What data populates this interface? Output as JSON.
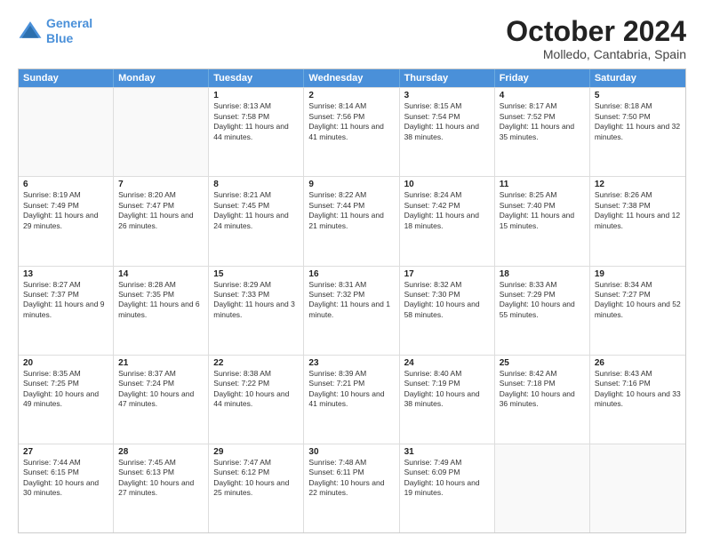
{
  "logo": {
    "line1": "General",
    "line2": "Blue"
  },
  "title": "October 2024",
  "location": "Molledo, Cantabria, Spain",
  "days_of_week": [
    "Sunday",
    "Monday",
    "Tuesday",
    "Wednesday",
    "Thursday",
    "Friday",
    "Saturday"
  ],
  "rows": [
    [
      {
        "day": "",
        "empty": true
      },
      {
        "day": "",
        "empty": true
      },
      {
        "day": "1",
        "sunrise": "Sunrise: 8:13 AM",
        "sunset": "Sunset: 7:58 PM",
        "daylight": "Daylight: 11 hours and 44 minutes."
      },
      {
        "day": "2",
        "sunrise": "Sunrise: 8:14 AM",
        "sunset": "Sunset: 7:56 PM",
        "daylight": "Daylight: 11 hours and 41 minutes."
      },
      {
        "day": "3",
        "sunrise": "Sunrise: 8:15 AM",
        "sunset": "Sunset: 7:54 PM",
        "daylight": "Daylight: 11 hours and 38 minutes."
      },
      {
        "day": "4",
        "sunrise": "Sunrise: 8:17 AM",
        "sunset": "Sunset: 7:52 PM",
        "daylight": "Daylight: 11 hours and 35 minutes."
      },
      {
        "day": "5",
        "sunrise": "Sunrise: 8:18 AM",
        "sunset": "Sunset: 7:50 PM",
        "daylight": "Daylight: 11 hours and 32 minutes."
      }
    ],
    [
      {
        "day": "6",
        "sunrise": "Sunrise: 8:19 AM",
        "sunset": "Sunset: 7:49 PM",
        "daylight": "Daylight: 11 hours and 29 minutes."
      },
      {
        "day": "7",
        "sunrise": "Sunrise: 8:20 AM",
        "sunset": "Sunset: 7:47 PM",
        "daylight": "Daylight: 11 hours and 26 minutes."
      },
      {
        "day": "8",
        "sunrise": "Sunrise: 8:21 AM",
        "sunset": "Sunset: 7:45 PM",
        "daylight": "Daylight: 11 hours and 24 minutes."
      },
      {
        "day": "9",
        "sunrise": "Sunrise: 8:22 AM",
        "sunset": "Sunset: 7:44 PM",
        "daylight": "Daylight: 11 hours and 21 minutes."
      },
      {
        "day": "10",
        "sunrise": "Sunrise: 8:24 AM",
        "sunset": "Sunset: 7:42 PM",
        "daylight": "Daylight: 11 hours and 18 minutes."
      },
      {
        "day": "11",
        "sunrise": "Sunrise: 8:25 AM",
        "sunset": "Sunset: 7:40 PM",
        "daylight": "Daylight: 11 hours and 15 minutes."
      },
      {
        "day": "12",
        "sunrise": "Sunrise: 8:26 AM",
        "sunset": "Sunset: 7:38 PM",
        "daylight": "Daylight: 11 hours and 12 minutes."
      }
    ],
    [
      {
        "day": "13",
        "sunrise": "Sunrise: 8:27 AM",
        "sunset": "Sunset: 7:37 PM",
        "daylight": "Daylight: 11 hours and 9 minutes."
      },
      {
        "day": "14",
        "sunrise": "Sunrise: 8:28 AM",
        "sunset": "Sunset: 7:35 PM",
        "daylight": "Daylight: 11 hours and 6 minutes."
      },
      {
        "day": "15",
        "sunrise": "Sunrise: 8:29 AM",
        "sunset": "Sunset: 7:33 PM",
        "daylight": "Daylight: 11 hours and 3 minutes."
      },
      {
        "day": "16",
        "sunrise": "Sunrise: 8:31 AM",
        "sunset": "Sunset: 7:32 PM",
        "daylight": "Daylight: 11 hours and 1 minute."
      },
      {
        "day": "17",
        "sunrise": "Sunrise: 8:32 AM",
        "sunset": "Sunset: 7:30 PM",
        "daylight": "Daylight: 10 hours and 58 minutes."
      },
      {
        "day": "18",
        "sunrise": "Sunrise: 8:33 AM",
        "sunset": "Sunset: 7:29 PM",
        "daylight": "Daylight: 10 hours and 55 minutes."
      },
      {
        "day": "19",
        "sunrise": "Sunrise: 8:34 AM",
        "sunset": "Sunset: 7:27 PM",
        "daylight": "Daylight: 10 hours and 52 minutes."
      }
    ],
    [
      {
        "day": "20",
        "sunrise": "Sunrise: 8:35 AM",
        "sunset": "Sunset: 7:25 PM",
        "daylight": "Daylight: 10 hours and 49 minutes."
      },
      {
        "day": "21",
        "sunrise": "Sunrise: 8:37 AM",
        "sunset": "Sunset: 7:24 PM",
        "daylight": "Daylight: 10 hours and 47 minutes."
      },
      {
        "day": "22",
        "sunrise": "Sunrise: 8:38 AM",
        "sunset": "Sunset: 7:22 PM",
        "daylight": "Daylight: 10 hours and 44 minutes."
      },
      {
        "day": "23",
        "sunrise": "Sunrise: 8:39 AM",
        "sunset": "Sunset: 7:21 PM",
        "daylight": "Daylight: 10 hours and 41 minutes."
      },
      {
        "day": "24",
        "sunrise": "Sunrise: 8:40 AM",
        "sunset": "Sunset: 7:19 PM",
        "daylight": "Daylight: 10 hours and 38 minutes."
      },
      {
        "day": "25",
        "sunrise": "Sunrise: 8:42 AM",
        "sunset": "Sunset: 7:18 PM",
        "daylight": "Daylight: 10 hours and 36 minutes."
      },
      {
        "day": "26",
        "sunrise": "Sunrise: 8:43 AM",
        "sunset": "Sunset: 7:16 PM",
        "daylight": "Daylight: 10 hours and 33 minutes."
      }
    ],
    [
      {
        "day": "27",
        "sunrise": "Sunrise: 7:44 AM",
        "sunset": "Sunset: 6:15 PM",
        "daylight": "Daylight: 10 hours and 30 minutes."
      },
      {
        "day": "28",
        "sunrise": "Sunrise: 7:45 AM",
        "sunset": "Sunset: 6:13 PM",
        "daylight": "Daylight: 10 hours and 27 minutes."
      },
      {
        "day": "29",
        "sunrise": "Sunrise: 7:47 AM",
        "sunset": "Sunset: 6:12 PM",
        "daylight": "Daylight: 10 hours and 25 minutes."
      },
      {
        "day": "30",
        "sunrise": "Sunrise: 7:48 AM",
        "sunset": "Sunset: 6:11 PM",
        "daylight": "Daylight: 10 hours and 22 minutes."
      },
      {
        "day": "31",
        "sunrise": "Sunrise: 7:49 AM",
        "sunset": "Sunset: 6:09 PM",
        "daylight": "Daylight: 10 hours and 19 minutes."
      },
      {
        "day": "",
        "empty": true
      },
      {
        "day": "",
        "empty": true
      }
    ]
  ]
}
